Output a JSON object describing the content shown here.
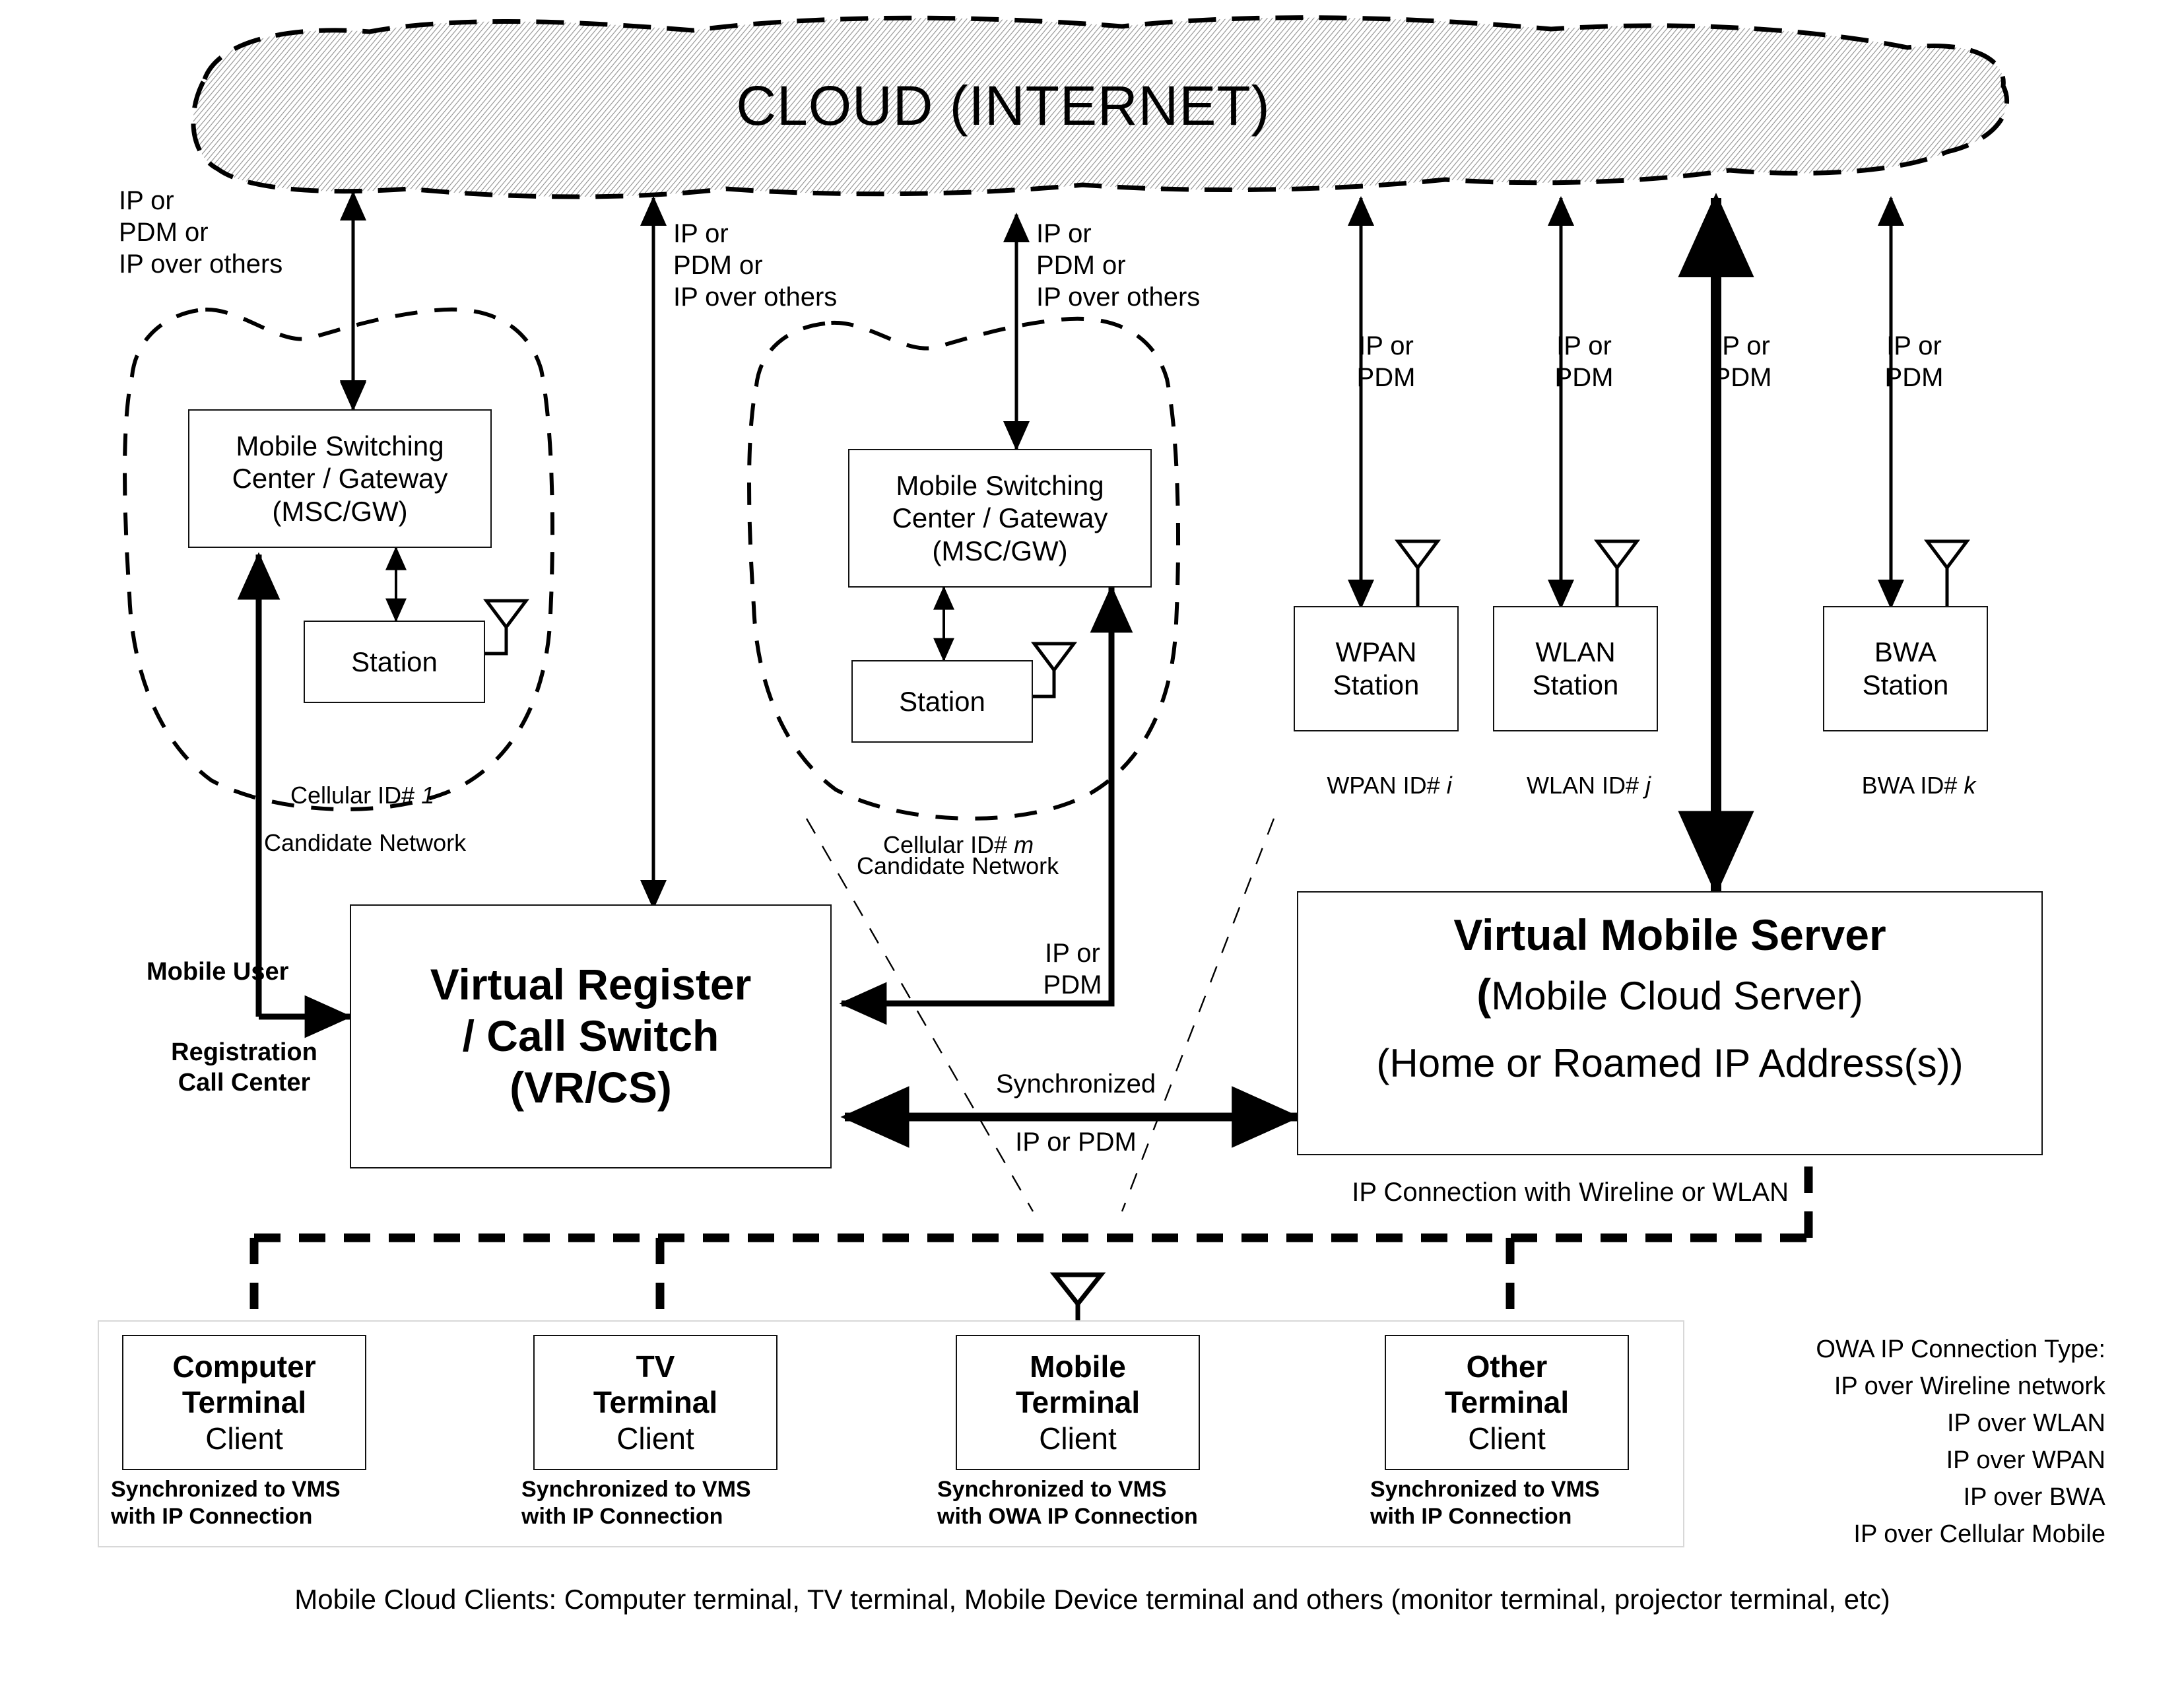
{
  "cloud": {
    "label": "CLOUD (INTERNET)"
  },
  "links": {
    "ip_pdm_others": "IP or\nPDM or\nIP over others",
    "ip_pdm": "IP or\nPDM",
    "synchronized": "Synchronized",
    "synchronized_proto": "IP or PDM",
    "wireline_wlan": "IP Connection with Wireline or WLAN"
  },
  "cellular_networks": [
    {
      "msc_label": "Mobile Switching\nCenter / Gateway\n(MSC/GW)",
      "station_label": "Station",
      "id_prefix": "Cellular ID# ",
      "id_value": "1",
      "candidate_label": "Candidate Network",
      "uplink_label": "IP or\nPDM or\nIP over others"
    },
    {
      "msc_label": "Mobile Switching\nCenter / Gateway\n(MSC/GW)",
      "station_label": "Station",
      "id_prefix": "Cellular ID# ",
      "id_value": "m",
      "candidate_label": "Candidate Network",
      "uplink_label": "IP or\nPDM or\nIP over others"
    }
  ],
  "access_stations": [
    {
      "name": "WPAN\nStation",
      "id_prefix": "WPAN ID# ",
      "id_value": "i",
      "uplink": "IP or\nPDM"
    },
    {
      "name": "WLAN\nStation",
      "id_prefix": "WLAN ID# ",
      "id_value": "j",
      "uplink": "IP or\nPDM"
    },
    {
      "name": "BWA\nStation",
      "id_prefix": "BWA ID# ",
      "id_value": "k",
      "uplink": "IP or\nPDM"
    }
  ],
  "vms_uplink": "IP or\nPDM",
  "vrcs": {
    "line1": "Virtual Register",
    "line2": "/ Call Switch",
    "line3": "(VR/CS)",
    "side_label_1": "Mobile User",
    "side_label_2": "Registration\nCall Center"
  },
  "vms": {
    "line1": "Virtual Mobile Server",
    "line2_bold_prefix": "(",
    "line2": "Mobile Cloud Server)",
    "line3": "(Home or Roamed IP Address(s))"
  },
  "terminals": [
    {
      "title": "Computer\nTerminal",
      "client": "Client",
      "note": "Synchronized to VMS\nwith IP Connection"
    },
    {
      "title": "TV\nTerminal",
      "client": "Client",
      "note": "Synchronized to VMS\nwith IP Connection"
    },
    {
      "title": "Mobile\nTerminal",
      "client": "Client",
      "note": "Synchronized to VMS\nwith OWA IP Connection"
    },
    {
      "title": "Other\nTerminal",
      "client": "Client",
      "note": "Synchronized to VMS\nwith IP Connection"
    }
  ],
  "legend": {
    "title": "OWA IP Connection Type:",
    "items": [
      "IP over Wireline network",
      "IP over WLAN",
      "IP over WPAN",
      "IP over BWA",
      "IP over Cellular Mobile"
    ]
  },
  "caption": "Mobile Cloud Clients: Computer terminal, TV terminal, Mobile Device terminal and others (monitor terminal, projector terminal, etc)",
  "colors": {
    "stroke": "#000000",
    "cloud_fill": "#e8e8e8",
    "box_border": "#111111"
  }
}
